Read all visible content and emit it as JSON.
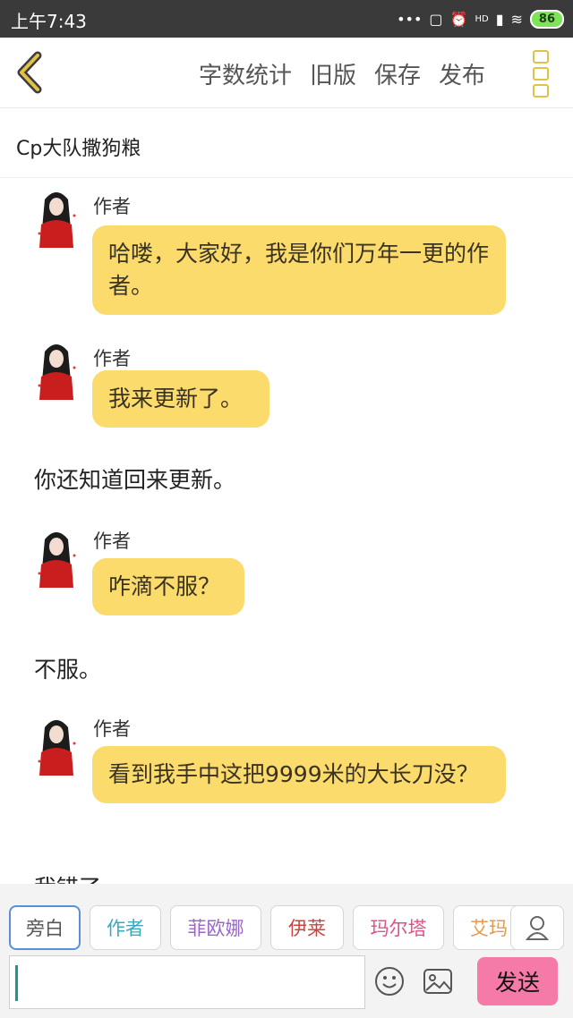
{
  "status_bar": {
    "time": "上午7:43",
    "signal_label": "HD",
    "battery": "86"
  },
  "top_bar": {
    "actions": [
      "字数统计",
      "旧版",
      "保存",
      "发布"
    ]
  },
  "story": {
    "title": "Cp大队撒狗粮"
  },
  "messages": [
    {
      "type": "character",
      "sender": "作者",
      "text": "哈喽，大家好，我是你们万年一更的作者。"
    },
    {
      "type": "character",
      "sender": "作者",
      "text": "我来更新了。"
    },
    {
      "type": "narration",
      "text": "你还知道回来更新。"
    },
    {
      "type": "character",
      "sender": "作者",
      "text": "咋滴不服？"
    },
    {
      "type": "narration",
      "text": "不服。"
    },
    {
      "type": "character",
      "sender": "作者",
      "text": "看到我手中这把9999米的大长刀没？"
    },
    {
      "type": "narration",
      "text": "我错了"
    }
  ],
  "characters": [
    {
      "name": "旁白",
      "color": "#555555",
      "selected": true
    },
    {
      "name": "作者",
      "color": "#39a9c0",
      "selected": false
    },
    {
      "name": "菲欧娜",
      "color": "#9a67c8",
      "selected": false
    },
    {
      "name": "伊莱",
      "color": "#d0413c",
      "selected": false
    },
    {
      "name": "玛尔塔",
      "color": "#e2508a",
      "selected": false
    },
    {
      "name": "艾玛",
      "color": "#e69a4a",
      "selected": false
    }
  ],
  "input": {
    "value": "",
    "placeholder": ""
  },
  "send_button": {
    "label": "发送"
  },
  "colors": {
    "bubble": "#fbdb6c",
    "send": "#f67aa8",
    "accent": "#e2c147"
  }
}
